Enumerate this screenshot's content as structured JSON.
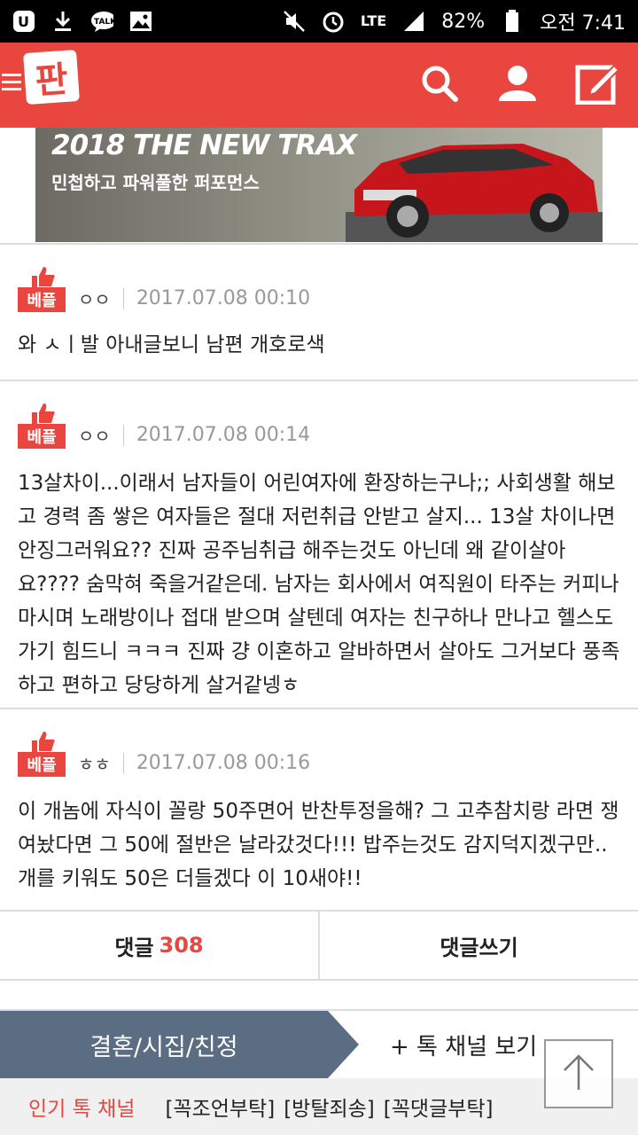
{
  "status_bar": {
    "battery": "82%",
    "time": "오전 7:41",
    "network": "LTE",
    "left_icons": [
      "u-plus-icon",
      "download-icon",
      "kakaotalk-icon",
      "image-icon"
    ],
    "right_icons": [
      "mute-icon",
      "alarm-icon",
      "signal-icon",
      "battery-icon"
    ]
  },
  "app_bar": {
    "logo_text": "판",
    "icons": [
      "search-icon",
      "profile-icon",
      "write-icon"
    ],
    "color": "#e8463f"
  },
  "banner": {
    "title": "2018 THE NEW TRAX",
    "subtitle": "민첩하고 파워풀한 퍼포먼스"
  },
  "comments": [
    {
      "badge": "베플",
      "author": "ㅇㅇ",
      "date": "2017.07.08 00:10",
      "text": "와 ㅅㅣ발 아내글보니 남편 개호로색"
    },
    {
      "badge": "베플",
      "author": "ㅇㅇ",
      "date": "2017.07.08 00:14",
      "text": "13살차이...이래서 남자들이 어린여자에 환장하는구나;; 사회생활 해보고 경력 좀 쌓은 여자들은 절대 저런취급 안받고 살지... 13살 차이나면 안징그러워요?? 진짜 공주님취급 해주는것도 아닌데 왜 같이살아요???? 숨막혀 죽을거같은데. 남자는 회사에서 여직원이 타주는 커피나 마시며 노래방이나 접대 받으며 살텐데 여자는 친구하나 만나고 헬스도 가기 힘드니 ㅋㅋㅋ 진짜 걍 이혼하고 알바하면서 살아도 그거보다 풍족하고 편하고 당당하게 살거같넹ㅎ"
    },
    {
      "badge": "베플",
      "author": "ㅎㅎ",
      "date": "2017.07.08 00:16",
      "text": "이 개놈에 자식이 꼴랑 50주면어 반찬투정을해? 그 고추참치랑 라면 쟁여놨다면 그 50에 절반은 날라갔것다!!! 밥주는것도 감지덕지겠구만.. 개를 키워도 50은 더들겠다 이 10새야!!"
    }
  ],
  "actions": {
    "comments_label": "댓글",
    "comments_count": "308",
    "write_label": "댓글쓰기"
  },
  "channel": {
    "current": "결혼/시집/친정",
    "more": "+ 톡 채널 보기",
    "tab_color": "#5a6d82"
  },
  "popular": {
    "title": "인기 톡 채널",
    "items": [
      "[꼭조언부탁]",
      "[방탈죄송]",
      "[꼭댓글부탁]"
    ]
  }
}
